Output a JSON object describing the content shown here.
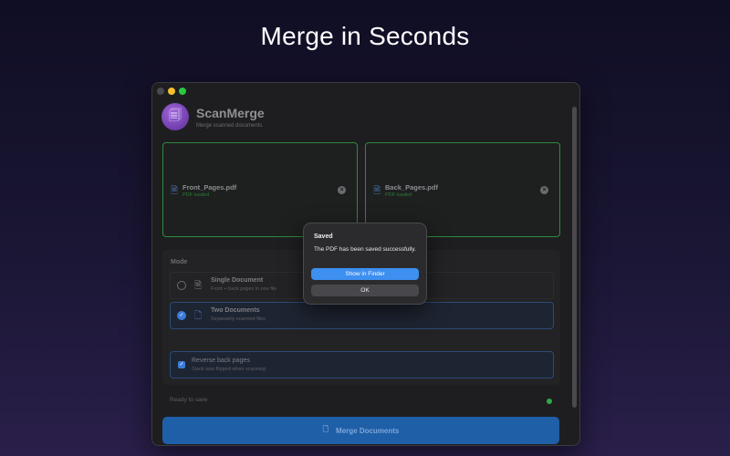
{
  "headline": "Merge in Seconds",
  "app": {
    "title": "ScanMerge",
    "subtitle": "Merge scanned documents"
  },
  "files": [
    {
      "name": "Front_Pages.pdf",
      "status": "PDF loaded"
    },
    {
      "name": "Back_Pages.pdf",
      "status": "PDF loaded"
    }
  ],
  "mode": {
    "label": "Mode",
    "options": [
      {
        "title": "Single Document",
        "subtitle": "Front + back pages in one file",
        "selected": false
      },
      {
        "title": "Two Documents",
        "subtitle": "Separately scanned files",
        "selected": true
      }
    ]
  },
  "reverse": {
    "title": "Reverse back pages",
    "subtitle": "Stack was flipped when scanning",
    "checked": true
  },
  "status": {
    "text": "Ready to save",
    "color": "#2faa4a"
  },
  "merge_button": {
    "label": "Merge Documents"
  },
  "dialog": {
    "title": "Saved",
    "message": "The PDF has been saved successfully.",
    "primary_label": "Show in Finder",
    "ok_label": "OK"
  },
  "colors": {
    "accent": "#3d8ff0",
    "success": "#2f8a3f"
  }
}
